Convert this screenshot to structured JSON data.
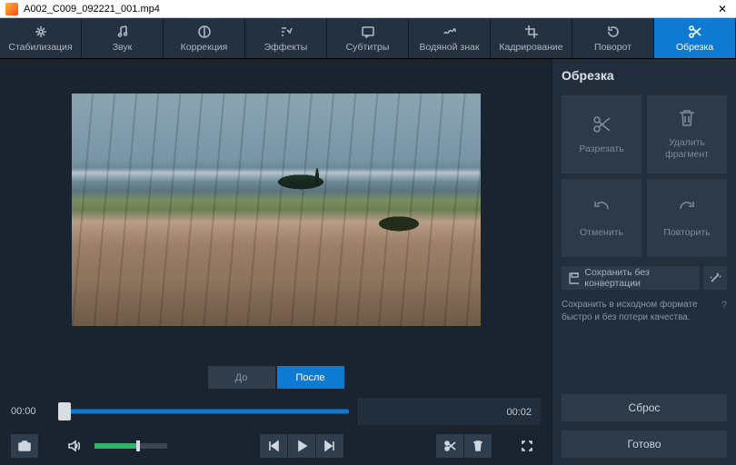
{
  "window": {
    "title": "A002_C009_092221_001.mp4",
    "close_glyph": "✕"
  },
  "tabs": {
    "stabilization": "Стабилизация",
    "sound": "Звук",
    "correction": "Коррекция",
    "effects": "Эффекты",
    "subtitles": "Субтитры",
    "watermark": "Водяной знак",
    "crop": "Кадрирование",
    "rotate": "Поворот",
    "trim": "Обрезка"
  },
  "before_after": {
    "before": "До",
    "after": "После"
  },
  "timeline": {
    "start": "00:00",
    "end": "00:02"
  },
  "panel": {
    "title": "Обрезка",
    "cut": "Разрезать",
    "delete_fragment": "Удалить\nфрагмент",
    "undo": "Отменить",
    "redo": "Повторить",
    "save_no_convert": "Сохранить без конвертации",
    "hint": "Сохранить в исходном формате быстро и без потери качества.",
    "reset": "Сброс",
    "done": "Готово"
  }
}
